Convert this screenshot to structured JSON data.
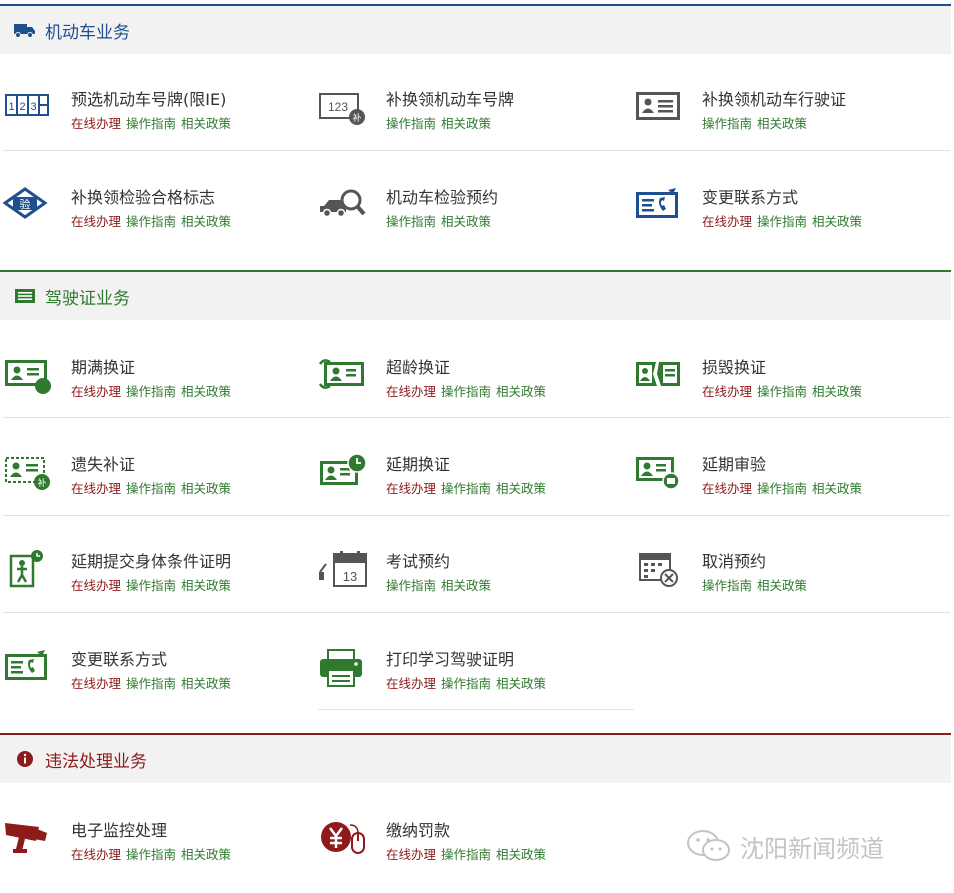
{
  "link_labels": {
    "online": "在线办理",
    "guide": "操作指南",
    "policy": "相关政策"
  },
  "sections": {
    "vehicle": {
      "title": "机动车业务",
      "items": [
        {
          "title": "预选机动车号牌(限IE)",
          "icon": "plate-123-icon"
        },
        {
          "title": "补换领机动车号牌",
          "icon": "plate-replace-icon"
        },
        {
          "title": "补换领机动车行驶证",
          "icon": "vehicle-license-icon"
        },
        {
          "title": "补换领检验合格标志",
          "icon": "inspection-badge-icon"
        },
        {
          "title": "机动车检验预约",
          "icon": "car-magnifier-icon"
        },
        {
          "title": "变更联系方式",
          "icon": "contact-card-icon"
        }
      ]
    },
    "license": {
      "title": "驾驶证业务",
      "items": [
        {
          "title": "期满换证",
          "icon": "license-expire-icon"
        },
        {
          "title": "超龄换证",
          "icon": "license-age-icon"
        },
        {
          "title": "损毁换证",
          "icon": "license-damaged-icon"
        },
        {
          "title": "遗失补证",
          "icon": "license-lost-icon"
        },
        {
          "title": "延期换证",
          "icon": "license-delay-icon"
        },
        {
          "title": "延期审验",
          "icon": "license-review-icon"
        },
        {
          "title": "延期提交身体条件证明",
          "icon": "person-clock-icon"
        },
        {
          "title": "考试预约",
          "icon": "calendar-13-icon",
          "calendar_day": "13"
        },
        {
          "title": "取消预约",
          "icon": "calendar-cancel-icon"
        },
        {
          "title": "变更联系方式",
          "icon": "contact-phone-icon"
        },
        {
          "title": "打印学习驾驶证明",
          "icon": "printer-icon"
        }
      ]
    },
    "violation": {
      "title": "违法处理业务",
      "items": [
        {
          "title": "电子监控处理",
          "icon": "camera-icon"
        },
        {
          "title": "缴纳罚款",
          "icon": "yen-payment-icon"
        }
      ]
    }
  },
  "icon_text": {
    "plate": "123",
    "inspection": "验",
    "supplement": "补"
  },
  "watermark": "沈阳新闻频道",
  "colors": {
    "blue": "#1e4f8e",
    "green": "#2f7a2f",
    "red": "#8e1a1a",
    "header_bg": "#f2f2f2"
  }
}
